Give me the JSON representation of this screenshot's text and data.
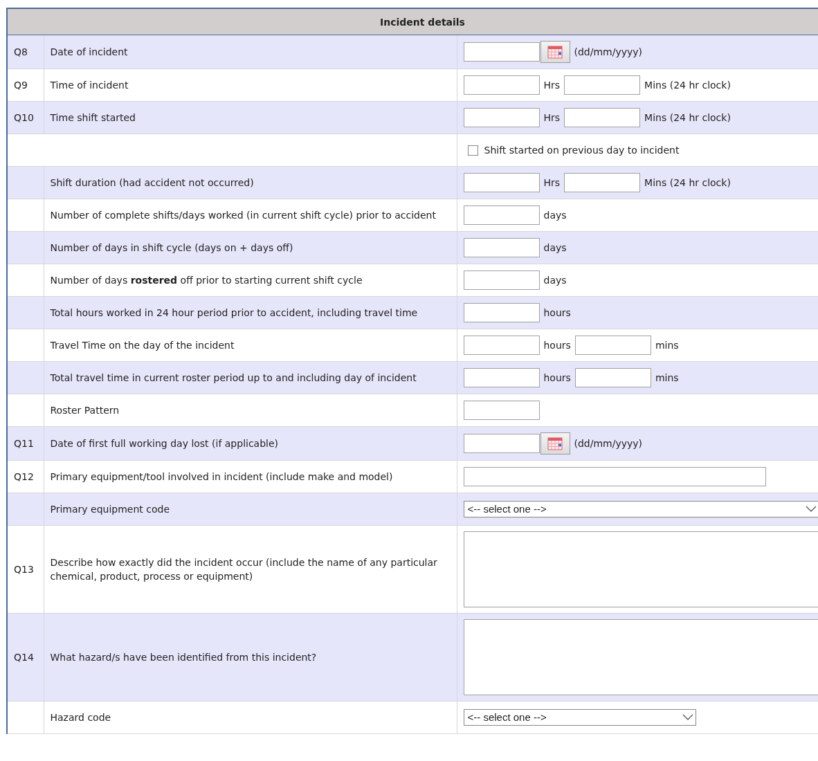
{
  "title": "Incident details",
  "rows": [
    {
      "number": "Q8",
      "label": "Date of incident",
      "answer": [
        {
          "kind": "date"
        },
        {
          "kind": "unit",
          "text": "(dd/mm/yyyy)"
        }
      ]
    },
    {
      "number": "Q9",
      "label": "Time of incident",
      "answer": [
        {
          "kind": "input"
        },
        {
          "kind": "unit",
          "text": "Hrs"
        },
        {
          "kind": "input"
        },
        {
          "kind": "unit",
          "text": "Mins (24 hr clock)"
        }
      ]
    },
    {
      "number": "Q10",
      "label": "Time shift started",
      "answer": [
        {
          "kind": "input"
        },
        {
          "kind": "unit",
          "text": "Hrs"
        },
        {
          "kind": "input"
        },
        {
          "kind": "unit",
          "text": "Mins (24 hr clock)"
        }
      ]
    },
    {
      "answer": [
        {
          "kind": "checkbox",
          "checked": false,
          "text": "Shift started on previous day to incident"
        }
      ]
    },
    {
      "label": "Shift duration (had accident not occurred)",
      "answer": [
        {
          "kind": "input"
        },
        {
          "kind": "unit",
          "text": "Hrs"
        },
        {
          "kind": "input"
        },
        {
          "kind": "unit",
          "text": "Mins (24 hr clock)"
        }
      ]
    },
    {
      "label": "Number of complete shifts/days worked (in current shift cycle) prior to accident",
      "answer": [
        {
          "kind": "input"
        },
        {
          "kind": "unit",
          "text": "days"
        }
      ]
    },
    {
      "label": "Number of days in shift cycle (days on + days off)",
      "answer": [
        {
          "kind": "input"
        },
        {
          "kind": "unit",
          "text": "days"
        }
      ]
    },
    {
      "label": "Number of days **rostered** off prior to starting current shift cycle",
      "answer": [
        {
          "kind": "input"
        },
        {
          "kind": "unit",
          "text": "days"
        }
      ]
    },
    {
      "label": "Total hours worked in 24 hour period prior to accident, including travel time",
      "answer": [
        {
          "kind": "input"
        },
        {
          "kind": "unit",
          "text": "hours"
        }
      ]
    },
    {
      "label": "Travel Time on the day of the incident",
      "answer": [
        {
          "kind": "input"
        },
        {
          "kind": "unit",
          "text": "hours"
        },
        {
          "kind": "input"
        },
        {
          "kind": "unit",
          "text": "mins"
        }
      ]
    },
    {
      "label": "Total travel time in current roster period up to and including day of incident",
      "answer": [
        {
          "kind": "input"
        },
        {
          "kind": "unit",
          "text": "hours"
        },
        {
          "kind": "input"
        },
        {
          "kind": "unit",
          "text": "mins"
        }
      ]
    },
    {
      "label": "Roster Pattern",
      "answer": [
        {
          "kind": "input"
        }
      ]
    },
    {
      "number": "Q11",
      "label": "Date of first full working day lost (if applicable)",
      "answer": [
        {
          "kind": "date"
        },
        {
          "kind": "unit",
          "text": "(dd/mm/yyyy)"
        }
      ]
    },
    {
      "number": "Q12",
      "label": "Primary equipment/tool involved in incident (include make and model)",
      "answer": [
        {
          "kind": "wide-input"
        }
      ]
    },
    {
      "label": "Primary equipment code",
      "answer": [
        {
          "kind": "wide-select",
          "text": "<-- select one -->"
        }
      ]
    },
    {
      "number": "Q13",
      "label": "Describe how exactly did the incident occur (include the name of any particular chemical, product, process or equipment)",
      "answer": [
        {
          "kind": "textarea"
        }
      ]
    },
    {
      "number": "Q14",
      "label": "What hazard/s have been identified from this incident?",
      "answer": [
        {
          "kind": "textarea"
        }
      ]
    },
    {
      "label": "Hazard code",
      "answer": [
        {
          "kind": "select",
          "text": "<-- select one -->"
        }
      ]
    }
  ]
}
